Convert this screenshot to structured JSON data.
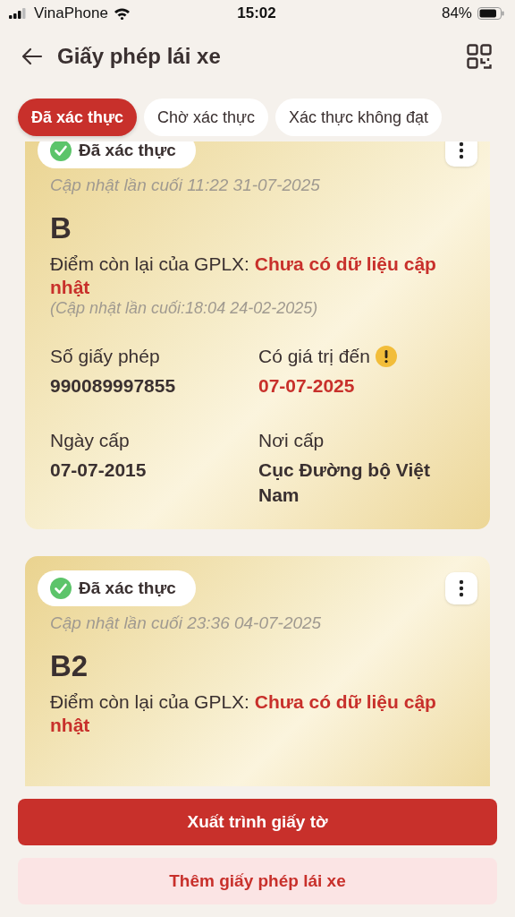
{
  "status_bar": {
    "carrier": "VinaPhone",
    "time": "15:02",
    "battery": "84%",
    "level": 0.84
  },
  "header": {
    "title": "Giấy phép lái xe"
  },
  "tabs": [
    {
      "label": "Đã xác thực",
      "selected": true
    },
    {
      "label": "Chờ xác thực",
      "selected": false
    },
    {
      "label": "Xác thực không đạt",
      "selected": false
    }
  ],
  "licenses": [
    {
      "status": "Đã xác thực",
      "verified": true,
      "updated": "Cập nhật lần cuối 11:22 31-07-2025",
      "class": "B",
      "points": "Điểm còn lại của GPLX: **Chưa có dữ liệu cập nhật**",
      "points_note": "(Cập nhật lần cuối:18:04 24-02-2025)",
      "fields": [
        {
          "label": "Số giấy phép",
          "value": "990089997855",
          "warning": false
        },
        {
          "label": "Có giá trị đến",
          "value": "07-07-2025",
          "warning": true
        },
        {
          "label": "Ngày cấp",
          "value": "07-07-2015",
          "warning": false
        },
        {
          "label": "Nơi cấp",
          "value": "Cục Đường bộ Việt Nam",
          "warning": false
        }
      ]
    },
    {
      "status": "Đã xác thực",
      "verified": true,
      "updated": "Cập nhật lần cuối 23:36 04-07-2025",
      "class": "B2",
      "points": "Điểm còn lại của GPLX: **Chưa có dữ liệu cập nhật**"
    }
  ],
  "actions": [
    {
      "label": "Xuất trình giấy tờ",
      "kind": "primary"
    },
    {
      "label": "Thêm giấy phép lái xe",
      "kind": "secondary"
    }
  ]
}
